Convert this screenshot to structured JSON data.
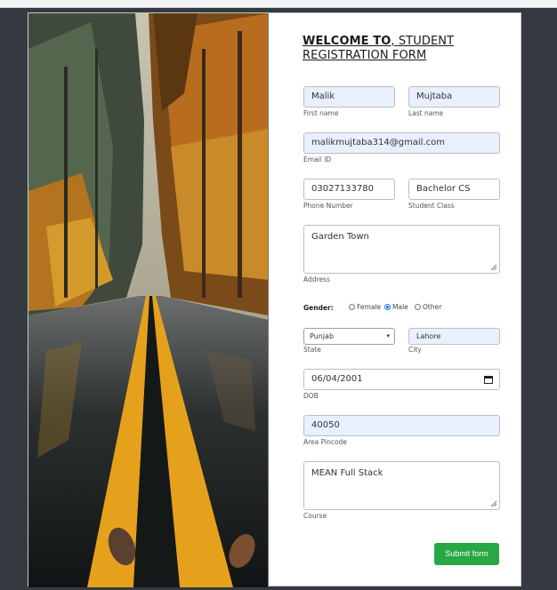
{
  "title": {
    "bold": "WELCOME TO",
    "rest": ", STUDENT REGISTRATION FORM"
  },
  "fields": {
    "first_name": {
      "value": "Malik",
      "label": "First name"
    },
    "last_name": {
      "value": "Mujtaba",
      "label": "Last name"
    },
    "email": {
      "value": "malikmujtaba314@gmail.com",
      "label": "Email ID"
    },
    "phone": {
      "value": "03027133780",
      "label": "Phone Number"
    },
    "student_class": {
      "value": "Bachelor CS",
      "label": "Student Class"
    },
    "address": {
      "value": "Garden Town",
      "label": "Address"
    },
    "state": {
      "value": "Punjab",
      "label": "State"
    },
    "city": {
      "value": "Lahore",
      "label": "City"
    },
    "dob": {
      "value": "06/04/2001",
      "label": "DOB"
    },
    "pincode": {
      "value": "40050",
      "label": "Area Pincode"
    },
    "course": {
      "value": "MEAN Full Stack",
      "label": "Course"
    }
  },
  "gender": {
    "label": "Gender:",
    "options": [
      "Female",
      "Male",
      "Other"
    ],
    "selected": "Male"
  },
  "submit_label": "Submit form",
  "colors": {
    "submit": "#28a745",
    "autofill": "#e8f0fe",
    "page_bg": "#343a40"
  },
  "icons": [
    "calendar-icon",
    "select-caret-icon",
    "resize-grip-icon"
  ]
}
